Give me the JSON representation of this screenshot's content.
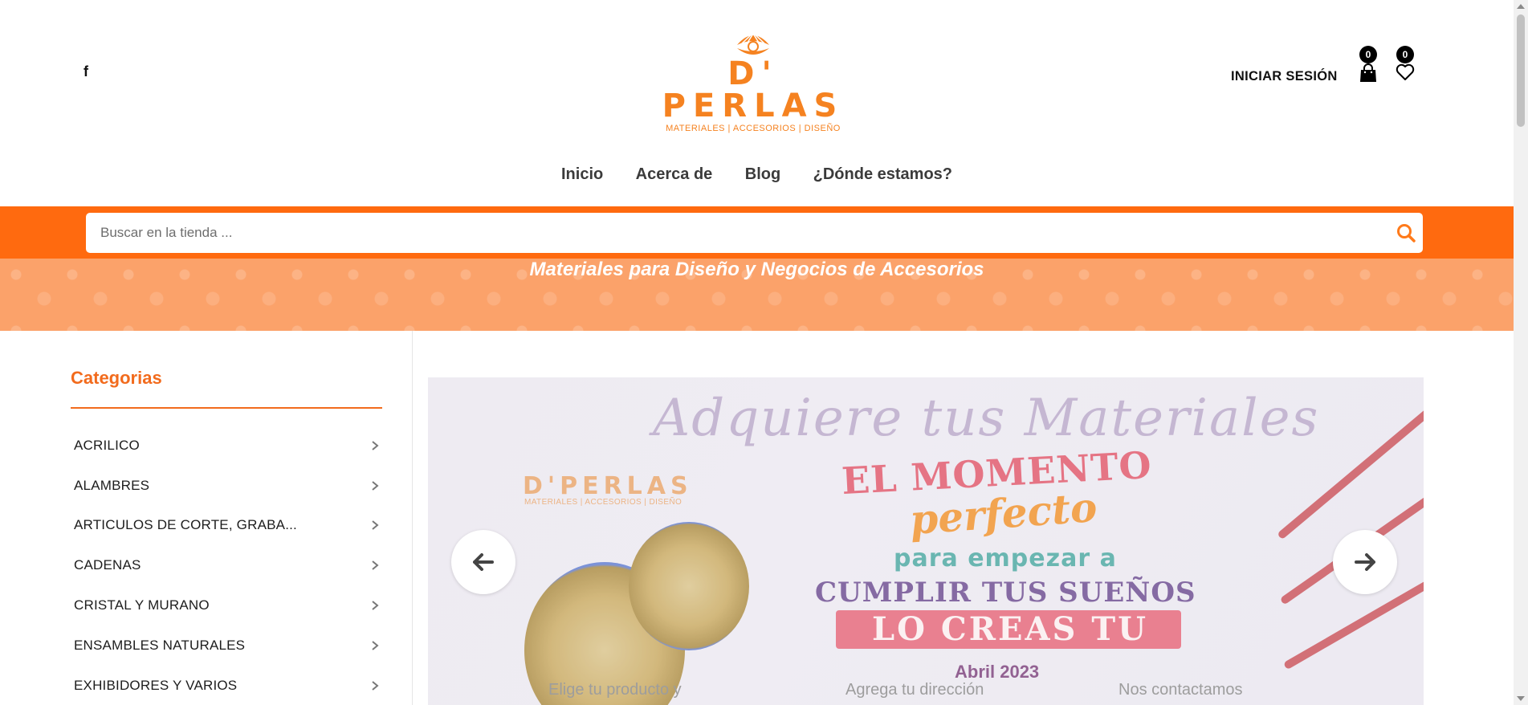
{
  "header": {
    "logo": {
      "name": "D' PERLAS",
      "tagline": "MATERIALES | ACCESORIOS | DISEÑO"
    },
    "login_label": "INICIAR SESIÓN",
    "cart_count": "0",
    "wishlist_count": "0",
    "social_icon": "facebook-icon",
    "cart_icon": "shopping-bag-icon",
    "wishlist_icon": "heart-icon"
  },
  "nav": {
    "items": [
      {
        "label": "Inicio"
      },
      {
        "label": "Acerca de"
      },
      {
        "label": "Blog"
      },
      {
        "label": "¿Dónde estamos?"
      }
    ]
  },
  "search": {
    "placeholder": "Buscar en la tienda ...",
    "value": "",
    "icon": "search-icon"
  },
  "promo": {
    "text": "Materiales para Diseño y Negocios de Accesorios"
  },
  "sidebar": {
    "title": "Categorias",
    "categories": [
      {
        "label": "ACRILICO"
      },
      {
        "label": "ALAMBRES"
      },
      {
        "label": "ARTICULOS DE CORTE, GRABA..."
      },
      {
        "label": "CADENAS"
      },
      {
        "label": "CRISTAL Y MURANO"
      },
      {
        "label": "ENSAMBLES NATURALES"
      },
      {
        "label": "EXHIBIDORES Y VARIOS"
      }
    ]
  },
  "slider": {
    "script_title": "Adquiere tus Materiales",
    "brand": "D'PERLAS",
    "brand_tagline": "MATERIALES | ACCESORIOS | DISEÑO",
    "headline_1": "EL MOMENTO",
    "headline_2": "perfecto",
    "headline_3": "para empezar a",
    "headline_4": "CUMPLIR TUS SUEÑOS",
    "headline_5": "LO CREAS TU",
    "date": "Abril 2023",
    "step_1": "Elige tu producto y",
    "step_2": "Agrega tu dirección",
    "step_3": "Nos contactamos",
    "prev_icon": "arrow-left-icon",
    "next_icon": "arrow-right-icon"
  },
  "colors": {
    "accent": "#ff6a0f",
    "promo_bg": "#fba26a",
    "category_title": "#f26b1d"
  }
}
